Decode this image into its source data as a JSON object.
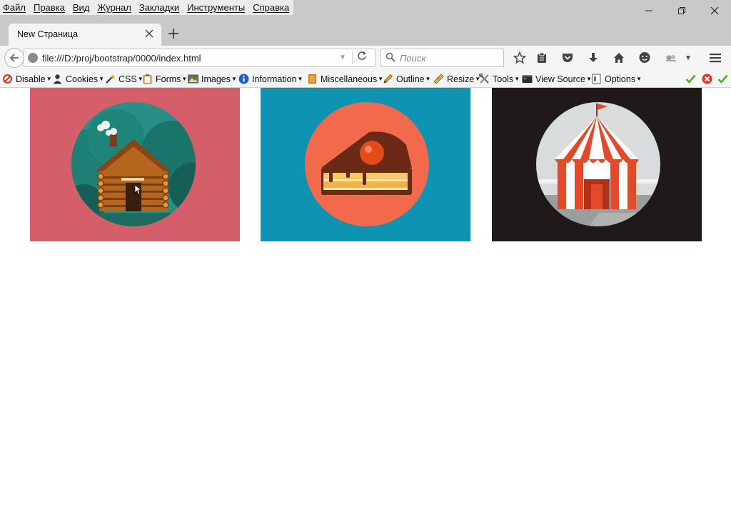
{
  "menu": {
    "items": [
      "Файл",
      "Правка",
      "Вид",
      "Журнал",
      "Закладки",
      "Инструменты",
      "Справка"
    ]
  },
  "tab": {
    "title": "New Страница"
  },
  "nav": {
    "url": "file:///D:/proj/bootstrap/0000/index.html",
    "search_placeholder": "Поиск"
  },
  "devtoolbar": {
    "items": [
      "Disable",
      "Cookies",
      "CSS",
      "Forms",
      "Images",
      "Information",
      "Miscellaneous",
      "Outline",
      "Resize",
      "Tools",
      "View Source",
      "Options"
    ]
  },
  "gallery": {
    "tiles": [
      {
        "subject": "log-cabin",
        "background": "#d45f6b",
        "circle": "#2a8e88"
      },
      {
        "subject": "cake-slice",
        "background": "#0f93b3",
        "circle": "#f26a4b"
      },
      {
        "subject": "circus-tent",
        "background": "#1f1919",
        "circle": "#d9dcdc"
      }
    ]
  },
  "colors": {
    "chrome": "#c9c9c9",
    "toolbar": "#f5f5f5",
    "status_ok": "#4caf2a",
    "status_error": "#e0342c"
  }
}
